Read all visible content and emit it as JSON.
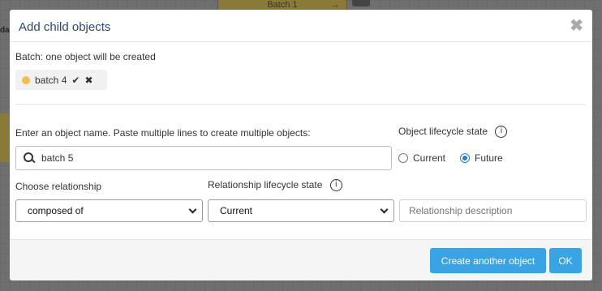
{
  "backdrop": {
    "node_label": "Batch 1",
    "node_arrow": "→",
    "tab_fragment": "da"
  },
  "modal": {
    "title": "Add child objects",
    "close_glyph": "✖",
    "batch_info": "Batch: one object will be created",
    "tag": {
      "label": "batch 4",
      "dot_color": "#f0c04a",
      "confirm_glyph": "✔",
      "remove_glyph": "✖"
    },
    "name_field": {
      "label": "Enter an object name. Paste multiple lines to create multiple objects:",
      "value": "batch 5"
    },
    "object_lifecycle": {
      "label": "Object lifecycle state",
      "info_glyph": "i",
      "options": [
        {
          "label": "Current",
          "checked": false
        },
        {
          "label": "Future",
          "checked": true
        }
      ]
    },
    "relationship": {
      "label": "Choose relationship",
      "selected": "composed of"
    },
    "relationship_lifecycle": {
      "label": "Relationship lifecycle state",
      "info_glyph": "i",
      "selected": "Current"
    },
    "relationship_description": {
      "placeholder": "Relationship description"
    },
    "footer": {
      "create_another_label": "Create another object",
      "ok_label": "OK",
      "button_color": "#3aa3e3"
    }
  }
}
